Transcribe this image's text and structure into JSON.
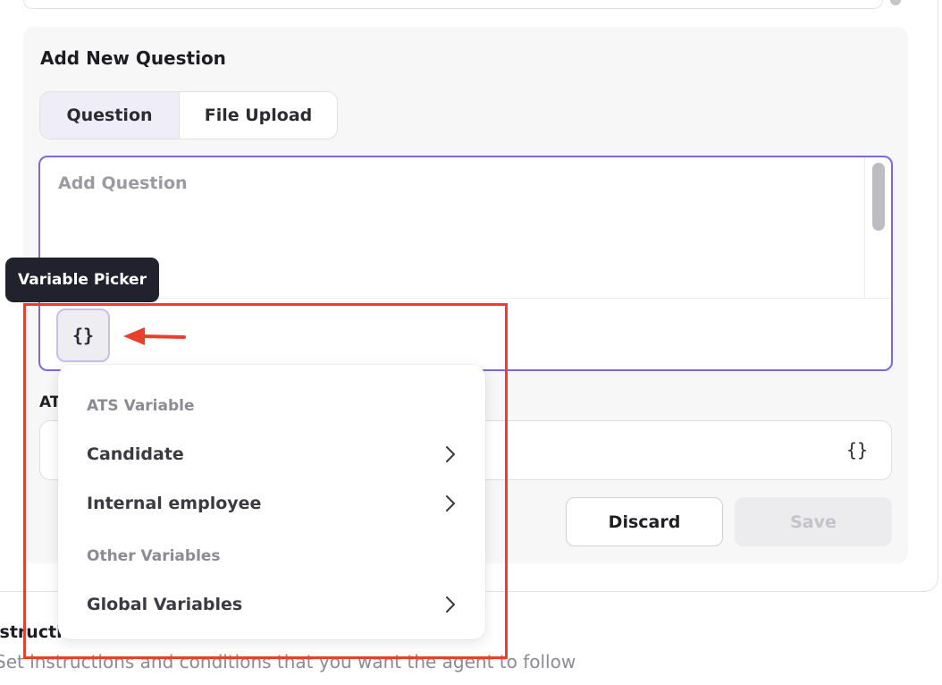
{
  "section": {
    "title": "Add New Question",
    "tabs": [
      {
        "label": "Question",
        "active": true
      },
      {
        "label": "File Upload",
        "active": false
      }
    ]
  },
  "question_input": {
    "placeholder": "Add Question",
    "value": ""
  },
  "variable_button": {
    "glyph": "{}",
    "icon": "curly-braces-icon"
  },
  "tooltip": {
    "text": "Variable Picker"
  },
  "ats_variable": {
    "label_visible": "AT",
    "glyph": "{}"
  },
  "buttons": {
    "discard": "Discard",
    "save": "Save"
  },
  "instructions": {
    "title_visible": "nstructi",
    "subtitle": "Set instructions and conditions that you want the agent to follow"
  },
  "menu": {
    "groups": [
      {
        "header": "ATS Variable",
        "items": [
          {
            "label": "Candidate",
            "icon": "chevron-right-icon"
          },
          {
            "label": "Internal employee",
            "icon": "chevron-right-icon"
          }
        ]
      },
      {
        "header": "Other Variables",
        "items": [
          {
            "label": "Global Variables",
            "icon": "chevron-right-icon"
          }
        ]
      }
    ]
  },
  "colors": {
    "accent": "#7c68e0",
    "annotation_red": "#e8402d",
    "tooltip_bg": "#22222e",
    "tab_active_bg": "#efedf8",
    "section_bg": "#f7f7f8"
  }
}
